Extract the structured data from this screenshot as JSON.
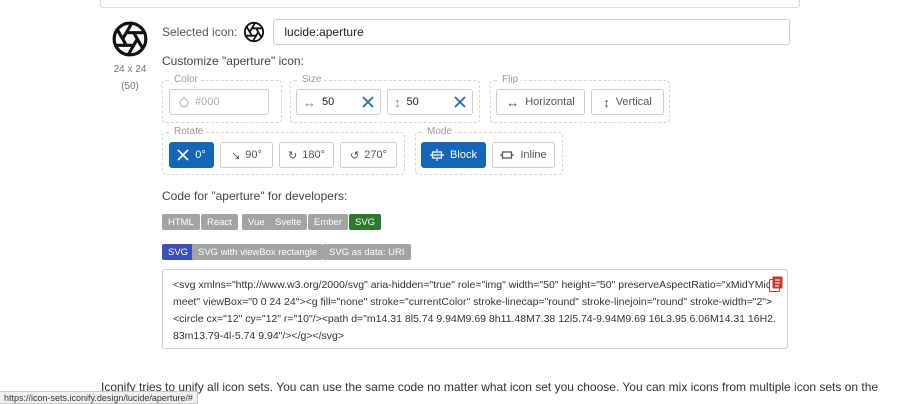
{
  "icon": {
    "size_label": "24 x 24",
    "count_label": "(50)"
  },
  "selected": {
    "label": "Selected icon:",
    "value": "lucide:aperture"
  },
  "customize": {
    "title": "Customize \"aperture\" icon:",
    "color": {
      "legend": "Color",
      "placeholder": "#000"
    },
    "size": {
      "legend": "Size",
      "width": "50",
      "height": "50"
    },
    "flip": {
      "legend": "Flip",
      "horizontal": "Horizontal",
      "vertical": "Vertical"
    },
    "rotate": {
      "legend": "Rotate",
      "options": [
        "0°",
        "90°",
        "180°",
        "270°"
      ]
    },
    "mode": {
      "legend": "Mode",
      "block": "Block",
      "inline": "Inline"
    }
  },
  "code": {
    "title": "Code for \"aperture\" for developers:",
    "frameworks": [
      "HTML",
      "React",
      "Vue",
      "Svelte",
      "Ember",
      "SVG"
    ],
    "variants": [
      "SVG",
      "SVG with viewBox rectangle",
      "SVG as data: URI"
    ],
    "snippet": "<svg xmlns=\"http://www.w3.org/2000/svg\" aria-hidden=\"true\" role=\"img\" width=\"50\" height=\"50\" preserveAspectRatio=\"xMidYMid meet\" viewBox=\"0 0 24 24\"><g fill=\"none\" stroke=\"currentColor\" stroke-linecap=\"round\" stroke-linejoin=\"round\" stroke-width=\"2\"><circle cx=\"12\" cy=\"12\" r=\"10\"/><path d=\"m14.31 8l5.74 9.94M9.69 8h11.48M7.38 12l5.74-9.94M9.69 16L3.95 6.06M14.31 16H2.83m13.79-4l-5.74 9.94\"/></g></svg>"
  },
  "footer": {
    "text": "Iconify tries to unify all icon sets. You can use the same code no matter what icon set you choose. You can mix icons from multiple icon sets on the",
    "status_url": "https://icon-sets.iconify.design/lucide/aperture/#"
  },
  "colors": {
    "accent": "#1565b8",
    "tab_active": "#2d7a2f",
    "variant_active": "#3c4fb8",
    "tab_inactive": "#a3a3a3"
  }
}
